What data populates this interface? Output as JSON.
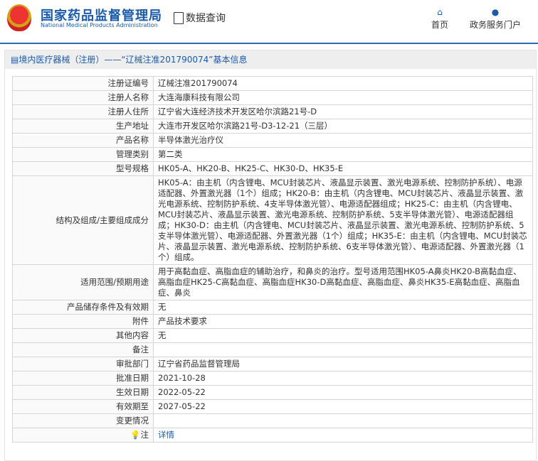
{
  "header": {
    "title_cn": "国家药品监督管理局",
    "title_en": "National Medical Products Administration",
    "data_query": "数据查询",
    "nav": [
      {
        "label": "首页"
      },
      {
        "label": "政务服务门户"
      }
    ]
  },
  "panel": {
    "title": "境内医疗器械（注册）——“辽械注准201790074”基本信息"
  },
  "rows": [
    {
      "label": "注册证编号",
      "value": "辽械注准201790074"
    },
    {
      "label": "注册人名称",
      "value": "大连海康科技有限公司"
    },
    {
      "label": "注册人住所",
      "value": "辽宁省大连经济技术开发区哈尔滨路21号-D"
    },
    {
      "label": "生产地址",
      "value": "大连市开发区哈尔滨路21号-D3-12-21（三层）"
    },
    {
      "label": "产品名称",
      "value": "半导体激光治疗仪"
    },
    {
      "label": "管理类别",
      "value": "第二类"
    },
    {
      "label": "型号规格",
      "value": "HK05-A、HK20-B、HK25-C、HK30-D、HK35-E"
    },
    {
      "label": "结构及组成/主要组成成分",
      "value": "HK05-A：由主机（内含锂电、MCU封装芯片、液晶显示装置、激光电源系统、控制防护系统）、电源适配器、外置激光器（1个）组成；HK20-B：由主机（内含锂电、MCU封装芯片、液晶显示装置、激光电源系统、控制防护系统、4支半导体激光管）、电源适配器组成；HK25-C：由主机（内含锂电、MCU封装芯片、液晶显示装置、激光电源系统、控制防护系统、5支半导体激光管）、电源适配器组成；HK30-D：由主机（内含锂电、MCU封装芯片、液晶显示装置、激光电源系统、控制防护系统、5支半导体激光管）、电源适配器、外置激光器（1个）组成；HK35-E：由主机（内含锂电、MCU封装芯片、液晶显示装置、激光电源系统、控制防护系统、6支半导体激光管）、电源适配器、外置激光器（1个）组成。"
    },
    {
      "label": "适用范围/预期用途",
      "value": "用于高黏血症、高脂血症的辅助治疗，和鼻炎的治疗。型号适用范围HK05-A鼻炎HK20-B高黏血症、高脂血症HK25-C高黏血症、高脂血症HK30-D高黏血症、高脂血症、鼻炎HK35-E高黏血症、高脂血症、鼻炎"
    },
    {
      "label": "产品储存条件及有效期",
      "value": "无"
    },
    {
      "label": "附件",
      "value": "产品技术要求"
    },
    {
      "label": "其他内容",
      "value": "无"
    },
    {
      "label": "备注",
      "value": ""
    },
    {
      "label": "审批部门",
      "value": "辽宁省药品监督管理局"
    },
    {
      "label": "批准日期",
      "value": "2021-10-28"
    },
    {
      "label": "生效日期",
      "value": "2022-05-22"
    },
    {
      "label": "有效期至",
      "value": "2027-05-22"
    },
    {
      "label": "变更情况",
      "value": ""
    }
  ],
  "note": {
    "label": "注",
    "link": "详情"
  }
}
